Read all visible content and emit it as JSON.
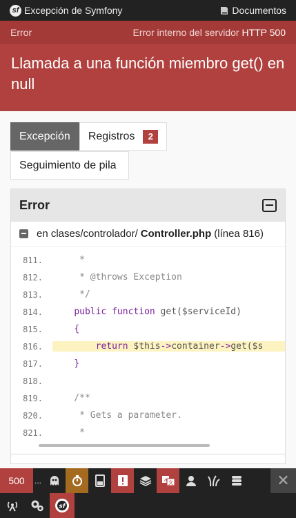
{
  "topbar": {
    "brand": "Excepción de Symfony",
    "logo_letter": "sf",
    "docs": "Documentos"
  },
  "error": {
    "label": "Error",
    "status_text": "Error interno del servidor",
    "status_code": "HTTP 500",
    "message": "Llamada a una función miembro get() en null"
  },
  "tabs": [
    {
      "label": "Excepción",
      "active": true
    },
    {
      "label": "Registros",
      "badge": "2"
    },
    {
      "label": "Seguimiento de pila"
    }
  ],
  "panel": {
    "title": "Error",
    "trace": {
      "prefix": "en clases/controlador/",
      "file": "Controller.php",
      "suffix": "(línea 816)"
    },
    "code": [
      {
        "ln": "811.",
        "text": "     *"
      },
      {
        "ln": "812.",
        "text": "     * @throws Exception"
      },
      {
        "ln": "813.",
        "text": "     */"
      },
      {
        "ln": "814.",
        "text": "    public function get($serviceId)"
      },
      {
        "ln": "815.",
        "text": "    {"
      },
      {
        "ln": "816.",
        "text": "        return $this->container->get($s"
      },
      {
        "ln": "817.",
        "text": "    }"
      },
      {
        "ln": "818.",
        "text": ""
      },
      {
        "ln": "819.",
        "text": "    /**"
      },
      {
        "ln": "820.",
        "text": "     * Gets a parameter."
      },
      {
        "ln": "821.",
        "text": "     *"
      }
    ],
    "highlight_line": "816."
  },
  "toolbar": {
    "status": "500",
    "ellipsis": "...",
    "close": "✕"
  },
  "colors": {
    "accent": "#b0413e",
    "highlight": "#fdf3c0"
  }
}
